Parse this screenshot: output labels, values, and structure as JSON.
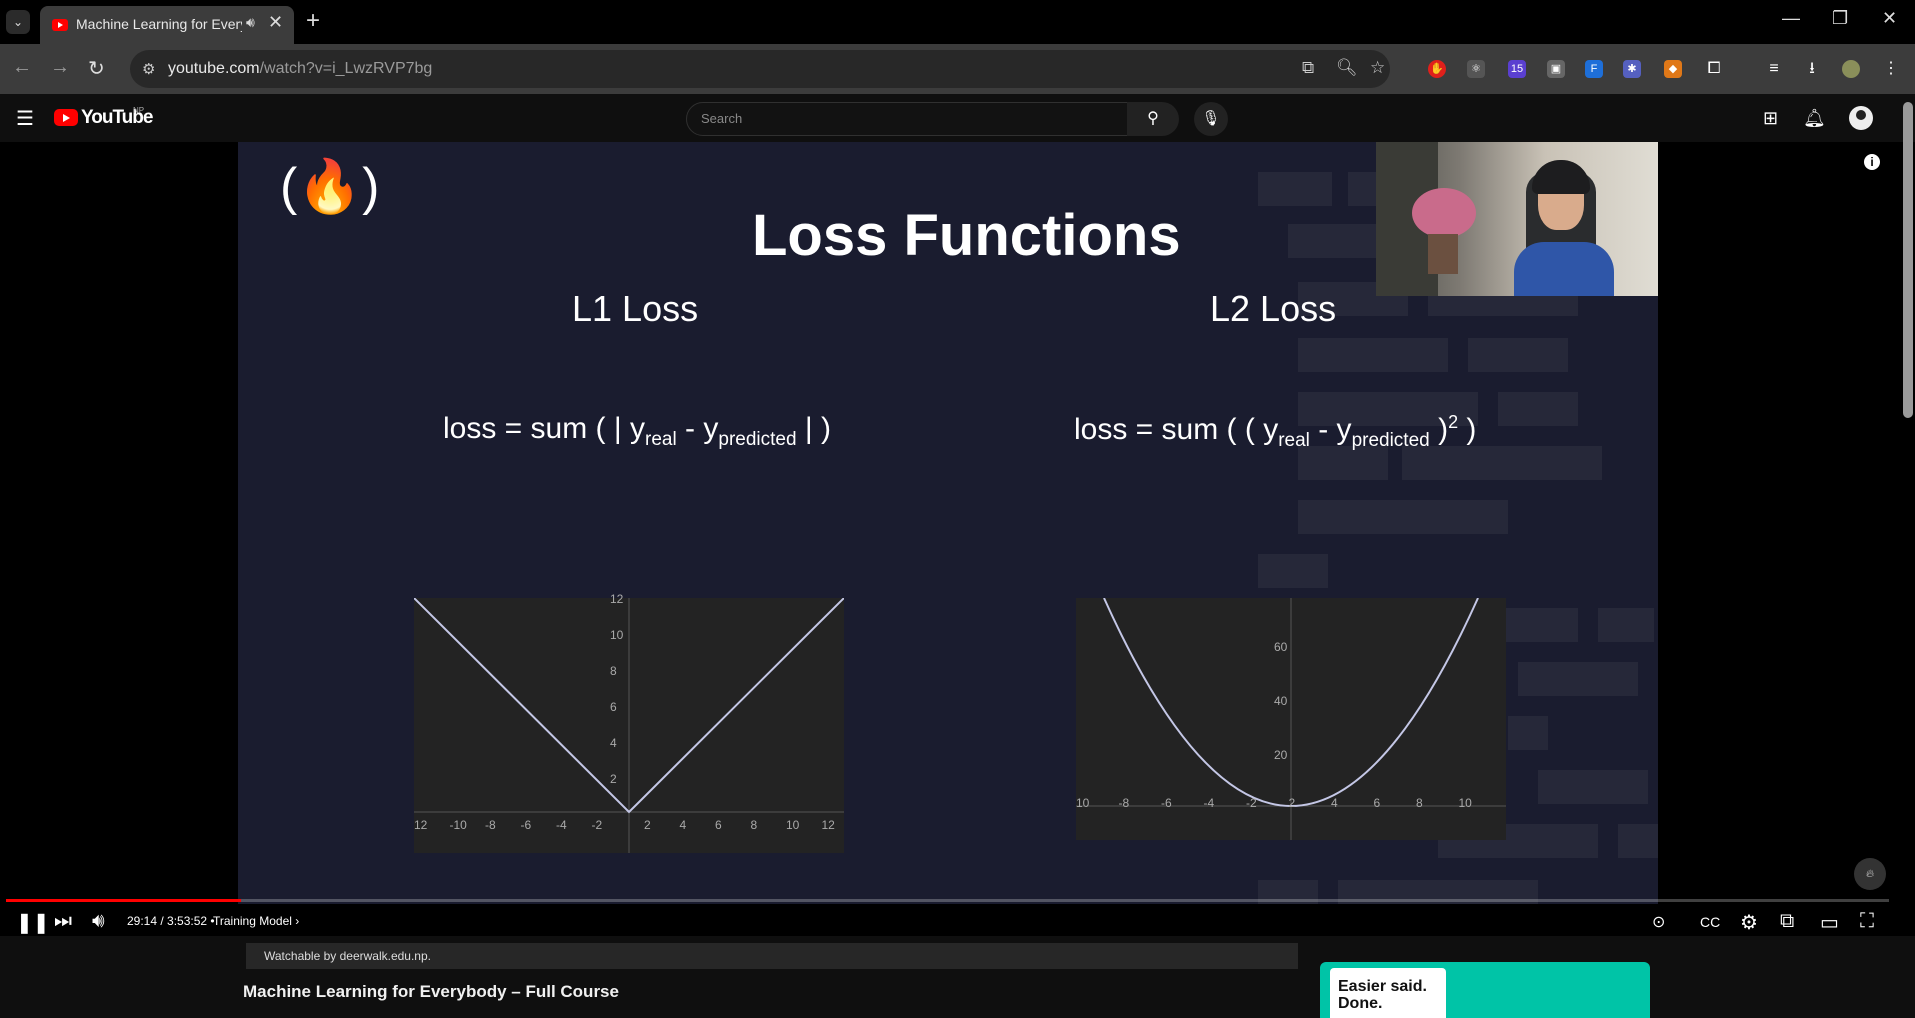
{
  "browser": {
    "tab_title": "Machine Learning for Everybody – Full Course",
    "tab_audio_icon": "speaker-icon",
    "url_host": "youtube.com",
    "url_path": "/watch?v=i_LwzRVP7bg",
    "extension_badge": "15"
  },
  "masthead": {
    "logo_text": "YouTube",
    "country_code": "NP",
    "search_placeholder": "Search"
  },
  "slide": {
    "logo_text": "(🔥)",
    "title": "Loss Functions",
    "left": {
      "heading": "L1 Loss",
      "formula_prefix": "loss = sum ( | y",
      "sub_real": "real",
      "minus": " - y",
      "sub_pred": "predicted",
      "formula_suffix": " | )",
      "y_ticks": [
        "12",
        "10",
        "8",
        "6",
        "4",
        "2"
      ],
      "x_ticks": [
        "12",
        "-10",
        "-8",
        "-6",
        "-4",
        "-2",
        "2",
        "4",
        "6",
        "8",
        "10",
        "12"
      ]
    },
    "right": {
      "heading": "L2 Loss",
      "formula_prefix": "loss = sum ( ( y",
      "sub_real": "real",
      "minus": " - y",
      "sub_pred": "predicted",
      "formula_close": " )",
      "sup": "2",
      "formula_suffix": " )",
      "y_ticks": [
        "60",
        "40",
        "20"
      ],
      "x_ticks": [
        "10",
        "-8",
        "-6",
        "-4",
        "-2",
        "2",
        "4",
        "6",
        "8",
        "10"
      ]
    }
  },
  "player": {
    "time_current": "29:14",
    "time_total": "3:53:52",
    "chapter": "Training Model",
    "progress_fraction": 0.125
  },
  "below": {
    "watchable_text": "Watchable by deerwalk.edu.np.",
    "video_title": "Machine Learning for Everybody – Full Course",
    "ad_line1": "Easier said.",
    "ad_line2": "Done."
  },
  "colors": {
    "youtube_red": "#ff0000",
    "slide_bg": "#1a1c2f",
    "ad_teal": "#00c4a7"
  }
}
